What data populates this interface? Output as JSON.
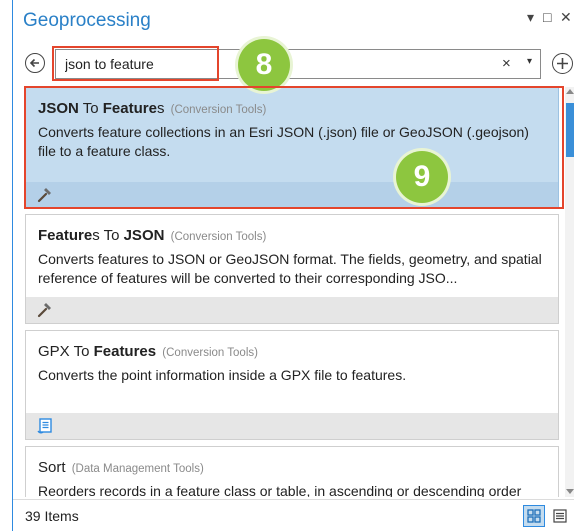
{
  "pane": {
    "title": "Geoprocessing",
    "controls": {
      "pin": "▾",
      "restore": "□",
      "close": "✕"
    }
  },
  "search": {
    "value": "json to feature",
    "clear": "×",
    "dropdown": "▾"
  },
  "results": [
    {
      "name_plain_before": "",
      "name_bold_1": "JSON",
      "name_plain_mid": " To ",
      "name_bold_2": "Feature",
      "name_plain_after": "s",
      "toolbox": "(Conversion Tools)",
      "description": "Converts feature collections in an Esri JSON (.json) file or GeoJSON (.geojson) file to a feature class.",
      "icon": "hammer-icon",
      "selected": true
    },
    {
      "name_bold_1": "Feature",
      "name_plain_mid": "s To ",
      "name_bold_2": "JSON",
      "toolbox": "(Conversion Tools)",
      "description": "Converts features to  JSON or GeoJSON format. The fields, geometry, and spatial reference of  features will be converted to their corresponding  JSO...",
      "icon": "hammer-icon",
      "selected": false
    },
    {
      "name_plain_before": "GPX To ",
      "name_bold_1": "Features",
      "toolbox": "(Conversion Tools)",
      "description": "Converts the point information inside a GPX file to features.",
      "icon": "script-icon",
      "selected": false
    },
    {
      "name_plain_before": "Sort",
      "toolbox": "(Data Management Tools)",
      "description": "Reorders records in a feature class or table, in ascending or descending order",
      "selected": false
    }
  ],
  "status": {
    "count_label": "39 Items"
  },
  "annotations": [
    {
      "label": "8",
      "color": "#8dc63f",
      "frame_color": "#e4452c"
    },
    {
      "label": "9",
      "color": "#8dc63f",
      "frame_color": "#e4452c"
    }
  ]
}
